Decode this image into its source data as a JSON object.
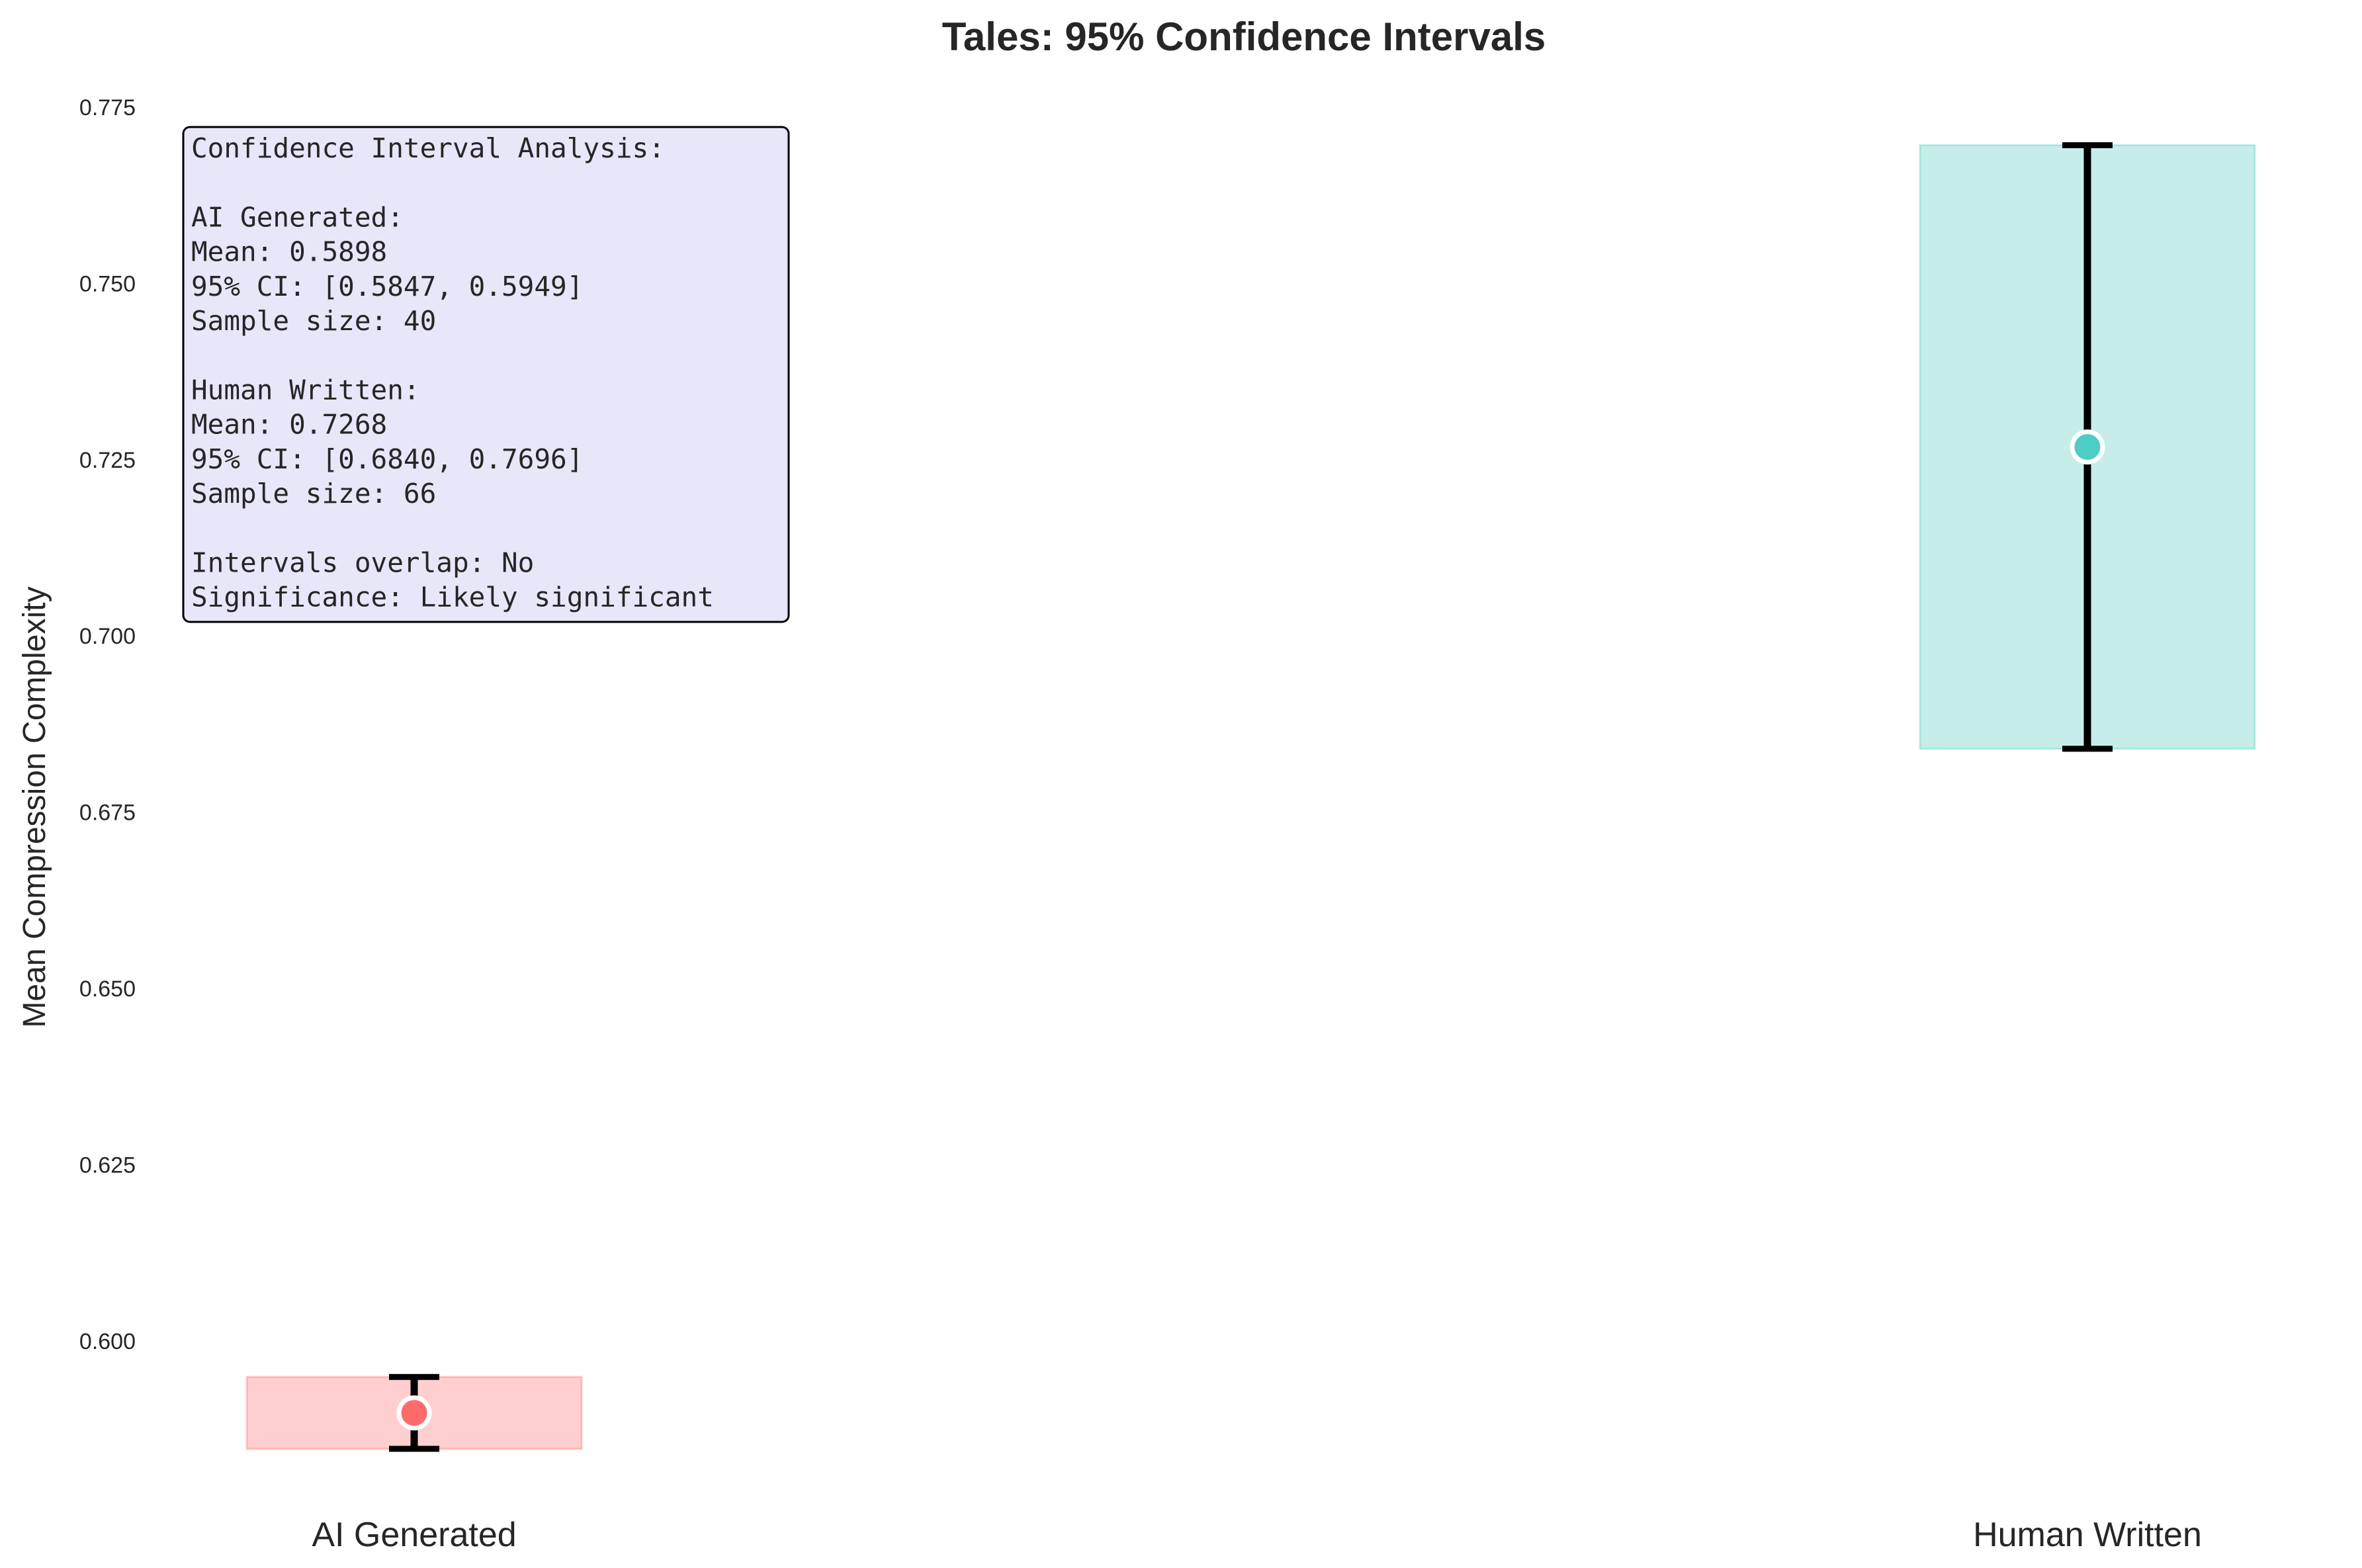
{
  "chart_data": {
    "type": "errorbar",
    "title": "Tales: 95% Confidence Intervals",
    "xlabel": "",
    "ylabel": "Mean Compression Complexity",
    "categories": [
      "AI Generated",
      "Human Written"
    ],
    "series": [
      {
        "name": "AI Generated",
        "mean": 0.5898,
        "ci_low": 0.5847,
        "ci_high": 0.5949,
        "color": "#ff6b6b",
        "band_color": "#ffcfcf"
      },
      {
        "name": "Human Written",
        "mean": 0.7268,
        "ci_low": 0.684,
        "ci_high": 0.7696,
        "color": "#4ecdc4",
        "band_color": "#c6edea"
      }
    ],
    "ylim": [
      0.58,
      0.778
    ],
    "yticks": [
      "0.600",
      "0.625",
      "0.650",
      "0.675",
      "0.700",
      "0.725",
      "0.750",
      "0.775"
    ],
    "grid": false,
    "annotation": {
      "lines": [
        "Confidence Interval Analysis:",
        "",
        "AI Generated:",
        "Mean: 0.5898",
        "95% CI: [0.5847, 0.5949]",
        "Sample size: 40",
        "",
        "Human Written:",
        "Mean: 0.7268",
        "95% CI: [0.6840, 0.7696]",
        "Sample size: 66",
        "",
        "Intervals overlap: No",
        "Significance: Likely significant"
      ],
      "background": "#e8e6f9",
      "border": "#000000"
    }
  }
}
